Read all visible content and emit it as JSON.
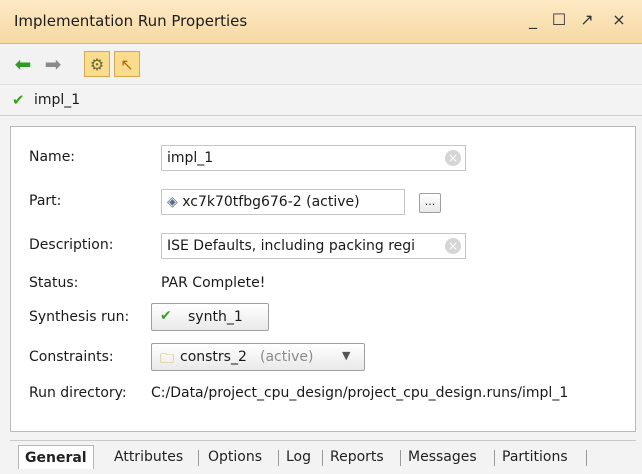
{
  "window": {
    "title": "Implementation Run Properties",
    "controls": {
      "minimize": "_",
      "maximize": "☐",
      "float": "↗",
      "close": "×"
    }
  },
  "toolbar": {
    "items": [
      {
        "name": "back",
        "icon": "green-left-arrow-icon"
      },
      {
        "name": "forward",
        "icon": "gray-right-arrow-icon"
      },
      {
        "name": "run-settings",
        "icon": "settings-gear-icon",
        "active": true
      },
      {
        "name": "select",
        "icon": "pointer-icon",
        "active": true
      }
    ]
  },
  "run": {
    "name": "impl_1"
  },
  "fields": {
    "name": {
      "label": "Name:",
      "value": "impl_1"
    },
    "part": {
      "label": "Part:",
      "value": "xc7k70tfbg676-2 (active)",
      "browse_label": "..."
    },
    "description": {
      "label": "Description:",
      "value": "ISE Defaults, including packing regi"
    },
    "status": {
      "label": "Status:",
      "value": "PAR Complete!"
    },
    "synthesis_run": {
      "label": "Synthesis run:",
      "value": "synth_1"
    },
    "constraints": {
      "label": "Constraints:",
      "value": "constrs_2",
      "suffix": "(active)"
    },
    "run_directory": {
      "label": "Run directory:",
      "value": "C:/Data/project_cpu_design/project_cpu_design.runs/impl_1"
    }
  },
  "tabs": [
    {
      "label": "General",
      "active": true
    },
    {
      "label": "Attributes"
    },
    {
      "label": "Options"
    },
    {
      "label": "Log"
    },
    {
      "label": "Reports"
    },
    {
      "label": "Messages"
    },
    {
      "label": "Partitions"
    }
  ],
  "colors": {
    "title_bar": "#f6d9a4",
    "active_tool": "#f9dc8d",
    "check_green": "#40a020"
  }
}
